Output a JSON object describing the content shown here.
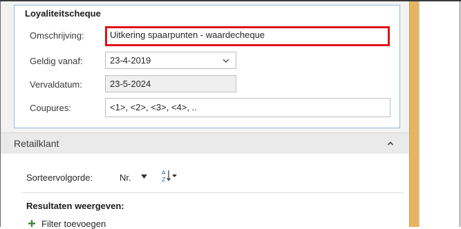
{
  "loyalty_section": {
    "title": "Loyaliteitscheque",
    "fields": [
      {
        "label": "Omschrijving:",
        "value": "Uitkering spaarpunten - waardecheque"
      },
      {
        "label": "Geldig vanaf:",
        "value": "23-4-2019"
      },
      {
        "label": "Vervaldatum:",
        "value": "23-5-2024"
      },
      {
        "label": "Coupures:",
        "value": "<1>, <2>, <3>, <4>, .."
      }
    ]
  },
  "retail_section": {
    "title": "Retailklant",
    "sort": {
      "label": "Sorteervolgorde:",
      "value": "Nr."
    },
    "results_title": "Resultaten weergeven:",
    "filter_label": "Filter toevoegen"
  },
  "colors": {
    "highlight_border": "#e0101a",
    "section_border": "#9bb6d9",
    "side_strip": "#e6b563"
  },
  "icons": [
    "chevron-down-icon",
    "collapse-up-icon",
    "caret-down-icon",
    "sort-az-icon",
    "plus-icon"
  ]
}
